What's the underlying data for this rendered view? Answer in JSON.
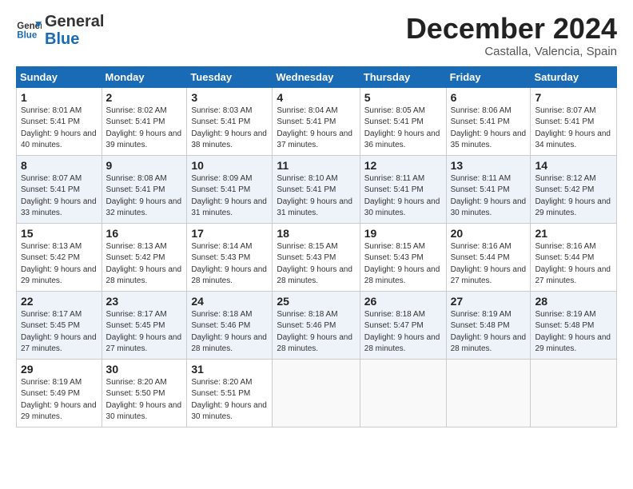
{
  "header": {
    "logo_line1": "General",
    "logo_line2": "Blue",
    "month": "December 2024",
    "location": "Castalla, Valencia, Spain"
  },
  "days_of_week": [
    "Sunday",
    "Monday",
    "Tuesday",
    "Wednesday",
    "Thursday",
    "Friday",
    "Saturday"
  ],
  "weeks": [
    [
      {
        "day": "1",
        "sunrise": "8:01 AM",
        "sunset": "5:41 PM",
        "daylight": "9 hours and 40 minutes."
      },
      {
        "day": "2",
        "sunrise": "8:02 AM",
        "sunset": "5:41 PM",
        "daylight": "9 hours and 39 minutes."
      },
      {
        "day": "3",
        "sunrise": "8:03 AM",
        "sunset": "5:41 PM",
        "daylight": "9 hours and 38 minutes."
      },
      {
        "day": "4",
        "sunrise": "8:04 AM",
        "sunset": "5:41 PM",
        "daylight": "9 hours and 37 minutes."
      },
      {
        "day": "5",
        "sunrise": "8:05 AM",
        "sunset": "5:41 PM",
        "daylight": "9 hours and 36 minutes."
      },
      {
        "day": "6",
        "sunrise": "8:06 AM",
        "sunset": "5:41 PM",
        "daylight": "9 hours and 35 minutes."
      },
      {
        "day": "7",
        "sunrise": "8:07 AM",
        "sunset": "5:41 PM",
        "daylight": "9 hours and 34 minutes."
      }
    ],
    [
      {
        "day": "8",
        "sunrise": "8:07 AM",
        "sunset": "5:41 PM",
        "daylight": "9 hours and 33 minutes."
      },
      {
        "day": "9",
        "sunrise": "8:08 AM",
        "sunset": "5:41 PM",
        "daylight": "9 hours and 32 minutes."
      },
      {
        "day": "10",
        "sunrise": "8:09 AM",
        "sunset": "5:41 PM",
        "daylight": "9 hours and 31 minutes."
      },
      {
        "day": "11",
        "sunrise": "8:10 AM",
        "sunset": "5:41 PM",
        "daylight": "9 hours and 31 minutes."
      },
      {
        "day": "12",
        "sunrise": "8:11 AM",
        "sunset": "5:41 PM",
        "daylight": "9 hours and 30 minutes."
      },
      {
        "day": "13",
        "sunrise": "8:11 AM",
        "sunset": "5:41 PM",
        "daylight": "9 hours and 30 minutes."
      },
      {
        "day": "14",
        "sunrise": "8:12 AM",
        "sunset": "5:42 PM",
        "daylight": "9 hours and 29 minutes."
      }
    ],
    [
      {
        "day": "15",
        "sunrise": "8:13 AM",
        "sunset": "5:42 PM",
        "daylight": "9 hours and 29 minutes."
      },
      {
        "day": "16",
        "sunrise": "8:13 AM",
        "sunset": "5:42 PM",
        "daylight": "9 hours and 28 minutes."
      },
      {
        "day": "17",
        "sunrise": "8:14 AM",
        "sunset": "5:43 PM",
        "daylight": "9 hours and 28 minutes."
      },
      {
        "day": "18",
        "sunrise": "8:15 AM",
        "sunset": "5:43 PM",
        "daylight": "9 hours and 28 minutes."
      },
      {
        "day": "19",
        "sunrise": "8:15 AM",
        "sunset": "5:43 PM",
        "daylight": "9 hours and 28 minutes."
      },
      {
        "day": "20",
        "sunrise": "8:16 AM",
        "sunset": "5:44 PM",
        "daylight": "9 hours and 27 minutes."
      },
      {
        "day": "21",
        "sunrise": "8:16 AM",
        "sunset": "5:44 PM",
        "daylight": "9 hours and 27 minutes."
      }
    ],
    [
      {
        "day": "22",
        "sunrise": "8:17 AM",
        "sunset": "5:45 PM",
        "daylight": "9 hours and 27 minutes."
      },
      {
        "day": "23",
        "sunrise": "8:17 AM",
        "sunset": "5:45 PM",
        "daylight": "9 hours and 27 minutes."
      },
      {
        "day": "24",
        "sunrise": "8:18 AM",
        "sunset": "5:46 PM",
        "daylight": "9 hours and 28 minutes."
      },
      {
        "day": "25",
        "sunrise": "8:18 AM",
        "sunset": "5:46 PM",
        "daylight": "9 hours and 28 minutes."
      },
      {
        "day": "26",
        "sunrise": "8:18 AM",
        "sunset": "5:47 PM",
        "daylight": "9 hours and 28 minutes."
      },
      {
        "day": "27",
        "sunrise": "8:19 AM",
        "sunset": "5:48 PM",
        "daylight": "9 hours and 28 minutes."
      },
      {
        "day": "28",
        "sunrise": "8:19 AM",
        "sunset": "5:48 PM",
        "daylight": "9 hours and 29 minutes."
      }
    ],
    [
      {
        "day": "29",
        "sunrise": "8:19 AM",
        "sunset": "5:49 PM",
        "daylight": "9 hours and 29 minutes."
      },
      {
        "day": "30",
        "sunrise": "8:20 AM",
        "sunset": "5:50 PM",
        "daylight": "9 hours and 30 minutes."
      },
      {
        "day": "31",
        "sunrise": "8:20 AM",
        "sunset": "5:51 PM",
        "daylight": "9 hours and 30 minutes."
      },
      null,
      null,
      null,
      null
    ]
  ]
}
